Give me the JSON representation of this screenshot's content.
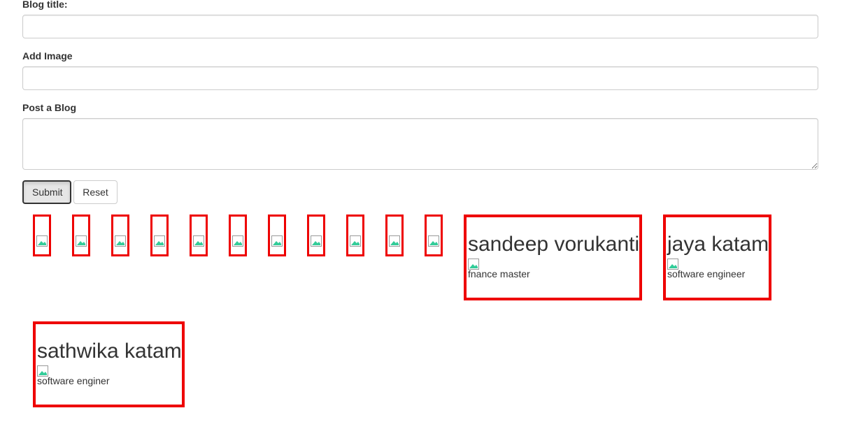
{
  "form": {
    "title_label": "Blog title:",
    "title_value": "",
    "image_label": "Add Image",
    "image_value": "",
    "post_label": "Post a Blog",
    "post_value": "",
    "submit_label": "Submit",
    "reset_label": "Reset"
  },
  "thumbnails": {
    "count": 11
  },
  "cards": [
    {
      "name": "sandeep vorukanti",
      "role": "fnance master"
    },
    {
      "name": "jaya katam",
      "role": "software engineer"
    },
    {
      "name": "sathwika katam",
      "role": "software enginer"
    }
  ],
  "colors": {
    "highlight_border": "#ee0000",
    "text": "#333333"
  }
}
